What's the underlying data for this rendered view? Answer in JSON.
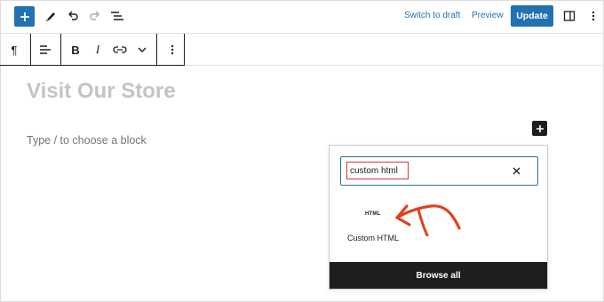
{
  "header": {
    "switch_to_draft_label": "Switch to draft",
    "preview_label": "Preview",
    "update_label": "Update"
  },
  "editor": {
    "post_title": "Visit Our Store",
    "block_placeholder": "Type / to choose a block"
  },
  "inserter": {
    "search_value": "custom html",
    "results": [
      {
        "icon_text": "HTML",
        "label": "Custom HTML"
      }
    ],
    "browse_all_label": "Browse all"
  },
  "colors": {
    "accent": "#2271b1",
    "annotation_red": "#e0421e",
    "dark": "#1e1e1e"
  }
}
